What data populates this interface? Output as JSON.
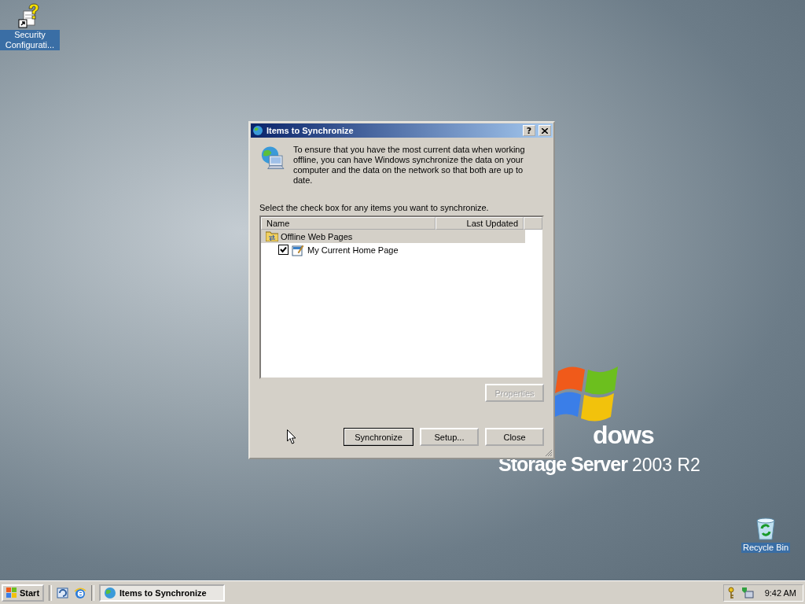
{
  "desktop_icons": [
    {
      "kind": "security",
      "label": "Security Configurati...",
      "selected": true
    },
    {
      "kind": "recycle",
      "label": "Recycle Bin",
      "selected": true
    }
  ],
  "wallpaper": {
    "logo_word": "dows",
    "product": "Storage Server",
    "version": "2003 R2"
  },
  "dialog": {
    "title": "Items to Synchronize",
    "help_button": "?",
    "intro": "To ensure that you have the most current data when working offline, you can have Windows synchronize the data on your computer and the data on the network so that both are up to date.",
    "instruction": "Select the check box for any items you want to synchronize.",
    "columns": [
      "Name",
      "Last Updated"
    ],
    "groups": [
      {
        "name": "Offline Web Pages",
        "selected": true,
        "children": [
          {
            "name": "My Current Home Page",
            "checked": true
          }
        ]
      }
    ],
    "buttons": [
      {
        "label": "Properties",
        "kind": "side",
        "disabled": true,
        "default": false
      },
      {
        "label": "Synchronize",
        "kind": "bottom",
        "disabled": false,
        "default": true
      },
      {
        "label": "Setup...",
        "kind": "bottom",
        "disabled": false,
        "default": false
      },
      {
        "label": "Close",
        "kind": "bottom",
        "disabled": false,
        "default": false
      }
    ]
  },
  "taskbar": {
    "start": "Start",
    "tasks": [
      {
        "label": "Items to Synchronize",
        "selected": true
      }
    ],
    "clock": "9:42 AM"
  }
}
